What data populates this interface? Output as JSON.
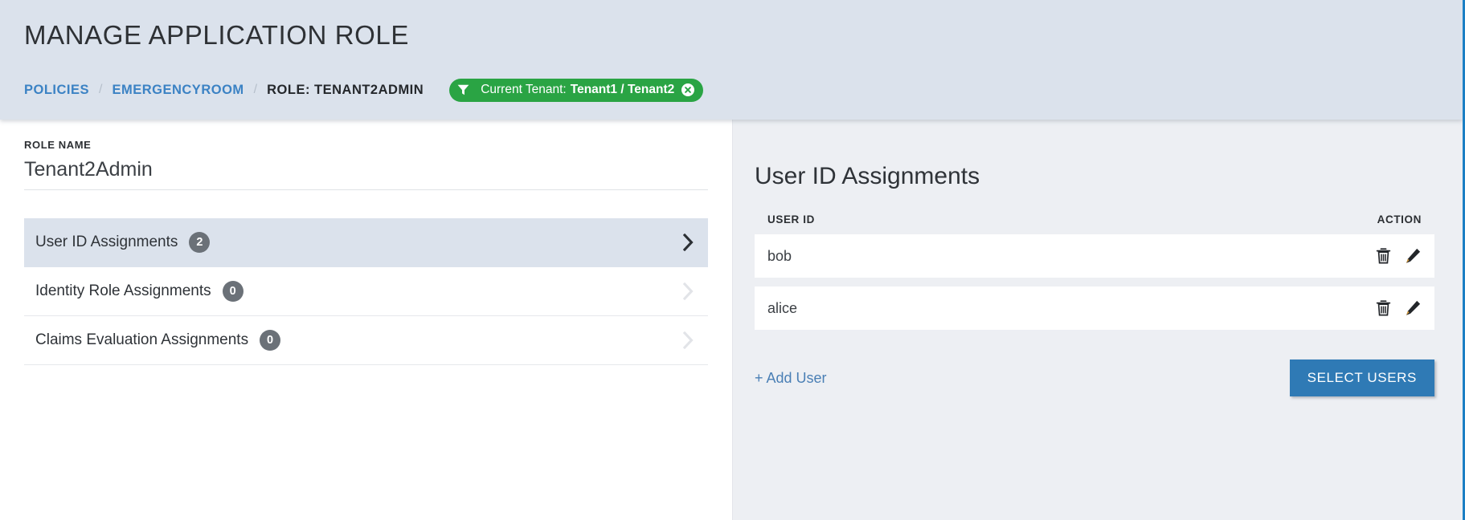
{
  "header": {
    "title": "MANAGE APPLICATION ROLE",
    "breadcrumb": {
      "items": [
        {
          "label": "POLICIES",
          "type": "link"
        },
        {
          "label": "EMERGENCYROOM",
          "type": "link"
        },
        {
          "label": "ROLE: TENANT2ADMIN",
          "type": "current"
        }
      ],
      "separator": "/"
    },
    "tenant_badge": {
      "icon": "funnel-icon",
      "label": "Current Tenant:",
      "value": "Tenant1 / Tenant2",
      "close_icon": "close-circle-icon",
      "color": "#2aa444"
    },
    "background": "#dbe2ec"
  },
  "left_panel": {
    "role_name_label": "ROLE NAME",
    "role_name_value": "Tenant2Admin",
    "assignments": [
      {
        "label": "User ID Assignments",
        "count": "2",
        "active": true,
        "chevron": "chevron-right-icon"
      },
      {
        "label": "Identity Role Assignments",
        "count": "0",
        "active": false,
        "chevron": "chevron-right-icon"
      },
      {
        "label": "Claims Evaluation Assignments",
        "count": "0",
        "active": false,
        "chevron": "chevron-right-icon"
      }
    ]
  },
  "right_panel": {
    "title": "User ID Assignments",
    "columns": {
      "user_id": "USER ID",
      "action": "ACTION"
    },
    "rows": [
      {
        "user_id": "bob",
        "delete_icon": "trash-icon",
        "edit_icon": "pencil-icon"
      },
      {
        "user_id": "alice",
        "delete_icon": "trash-icon",
        "edit_icon": "pencil-icon"
      }
    ],
    "add_user_label": "+ Add User",
    "select_users_label": "SELECT USERS",
    "button_color": "#2f7ab5",
    "background": "#edeff3"
  }
}
